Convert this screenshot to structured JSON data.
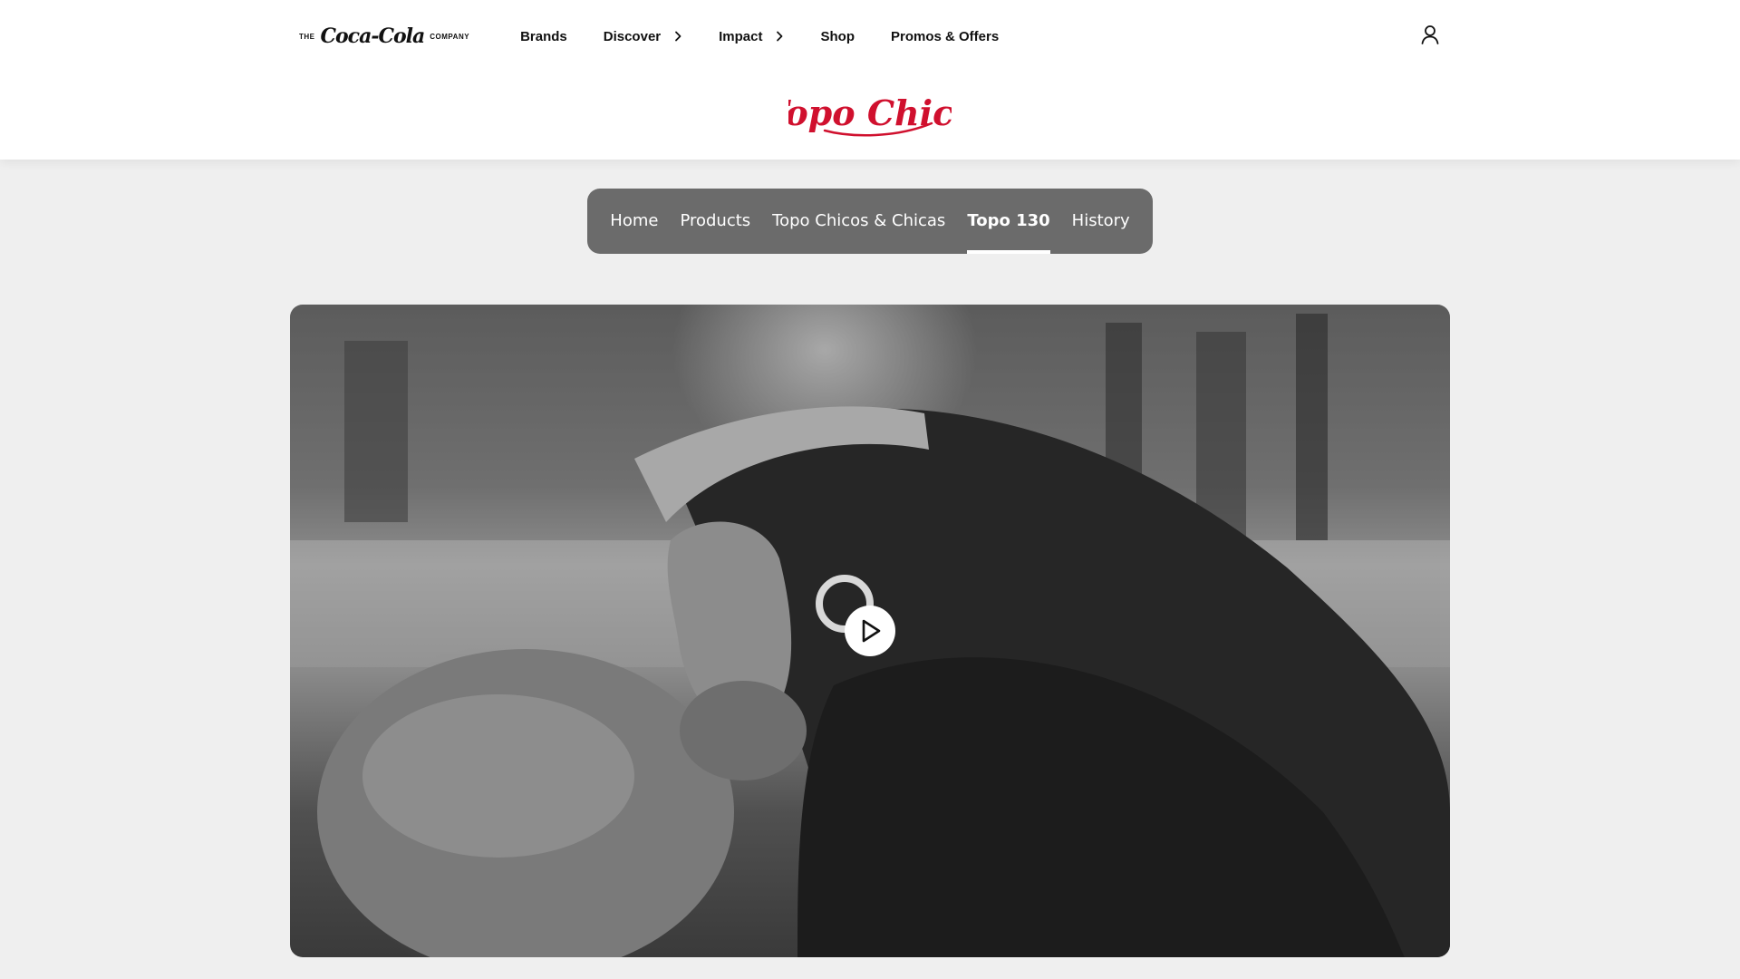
{
  "header": {
    "corporate_logo": {
      "prefix": "THE",
      "script": "Coca-Cola",
      "suffix": "COMPANY"
    },
    "nav": [
      {
        "label": "Brands",
        "has_chevron": false
      },
      {
        "label": "Discover",
        "has_chevron": true
      },
      {
        "label": "Impact",
        "has_chevron": true
      },
      {
        "label": "Shop",
        "has_chevron": false
      },
      {
        "label": "Promos & Offers",
        "has_chevron": false
      }
    ],
    "account_icon": "user-icon",
    "brand_logo_text": "Topo Chico",
    "brand_color": "#d0102e"
  },
  "sub_nav": {
    "items": [
      {
        "label": "Home",
        "active": false
      },
      {
        "label": "Products",
        "active": false
      },
      {
        "label": "Topo Chicos & Chicas",
        "active": false
      },
      {
        "label": "Topo 130",
        "active": true
      },
      {
        "label": "History",
        "active": false
      }
    ]
  },
  "video": {
    "play_icon": "play-icon"
  }
}
